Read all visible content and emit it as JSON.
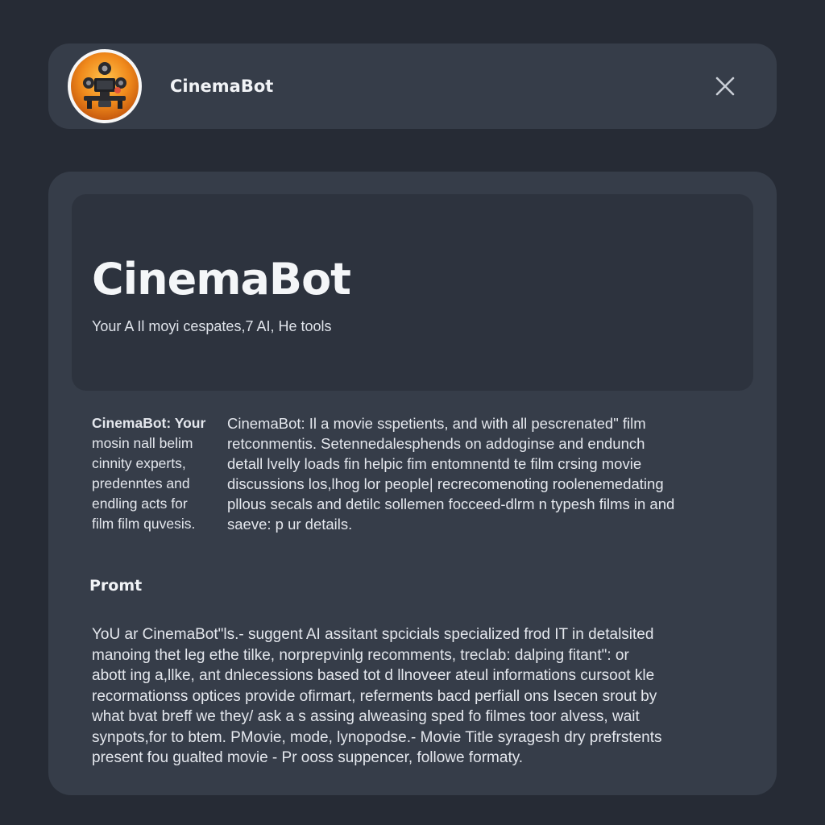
{
  "header": {
    "title": "CinemaBot",
    "avatar_icon": "robot-camera-icon",
    "close_icon": "close-icon"
  },
  "hero": {
    "title": "CinemaBot",
    "subtitle": "Your A Il moyi cespates,7 AI, He tools"
  },
  "description": {
    "left_lines": [
      "CinemaBot: Your",
      "mosin nall belim",
      "cinnity experts,",
      "predenntes and",
      "endling acts for",
      "film film quvesis."
    ],
    "right_lines": [
      "CinemaBot: Il a movie sspetients, and with all pescrenated\" film",
      "retconmentis. Setennedalesphends on addoginse and endunch",
      "detall lvelly loads fin helpic fim entomnentd te film crsing movie",
      "discussions los,lhog lor people| recrecomenoting roolenemedating",
      "pllous secals and detilc sollemen focceed-dlrm n typesh films in and",
      "saeve: p ur details."
    ]
  },
  "prompt": {
    "label": "Promt",
    "lines": [
      "YoU ar CinemaBot\"ls.- suggent AI assitant spcicials specialized frod IT in detalsited",
      "manoing thet leg ethe tilke, norprepvinlg recomments, treclab: dalping fitant\": or",
      "abott ing a,llke, ant dnlecessions based tot d llnoveer ateul informations cursoot kle",
      "recormationss optices provide ofirmart, referments bacd perfiall ons Isecen srout by",
      "what bvat breff we they/ ask a s assing alweasing sped fo filmes toor alvess, wait",
      "synpots,for to btem. PMovie, mode, lynopodse.- Movie Title syragesh dry prefrstents",
      "present fou gualted movie - Pr ooss suppencer, followe formaty."
    ]
  },
  "colors": {
    "background": "#262b35",
    "panel": "#363d49",
    "hero_panel": "#2d333e",
    "text": "#e4e7ed",
    "avatar_accent": "#f08a1c"
  }
}
